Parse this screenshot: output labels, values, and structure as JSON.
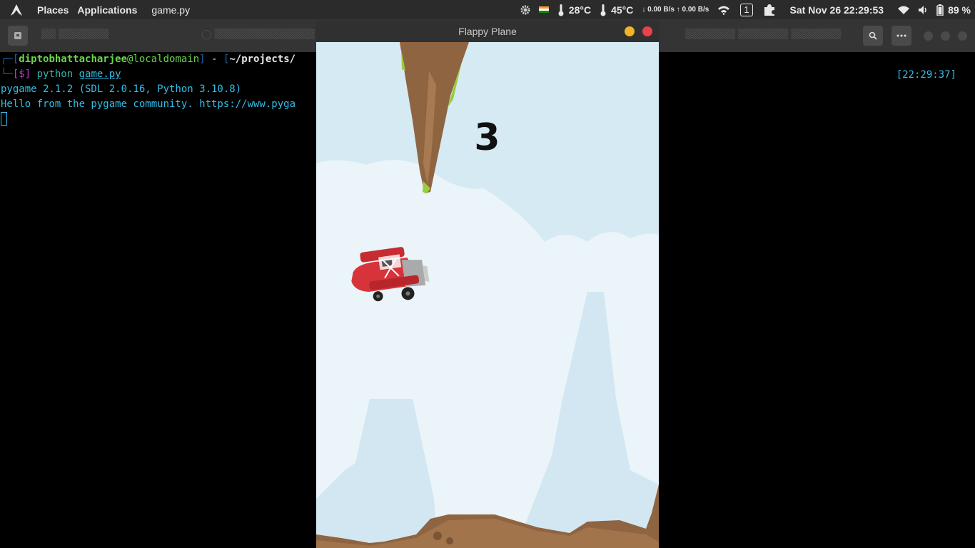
{
  "topbar": {
    "places": "Places",
    "applications": "Applications",
    "active_window": "game.py",
    "cpu_temp": "28°C",
    "gpu_temp": "45°C",
    "net_speed": "↓ 0.00 B/s ↑ 0.00 B/s",
    "workspace": "1",
    "datetime": "Sat Nov 26  22:29:53",
    "battery": "89 %"
  },
  "terminal": {
    "prompt_user": "diptobhattacharjee",
    "prompt_at": "@",
    "prompt_host": "localdomain",
    "prompt_sep": " - ",
    "prompt_path": "~/projects/",
    "prompt_dollar": "[$]",
    "command": "python",
    "command_arg": "game.py",
    "output_line1": "pygame 2.1.2 (SDL 2.0.16, Python 3.10.8)",
    "output_line2": "Hello from the pygame community. https://www.pyga",
    "timestamp": "[22:29:37]"
  },
  "game_window": {
    "title": "Flappy Plane",
    "score": "3"
  },
  "colors": {
    "sky": "#d6eaf3",
    "cloud": "#eaf4f9",
    "rock": "#8e6441",
    "grass": "#9acc3c",
    "plane": "#d6343a"
  }
}
